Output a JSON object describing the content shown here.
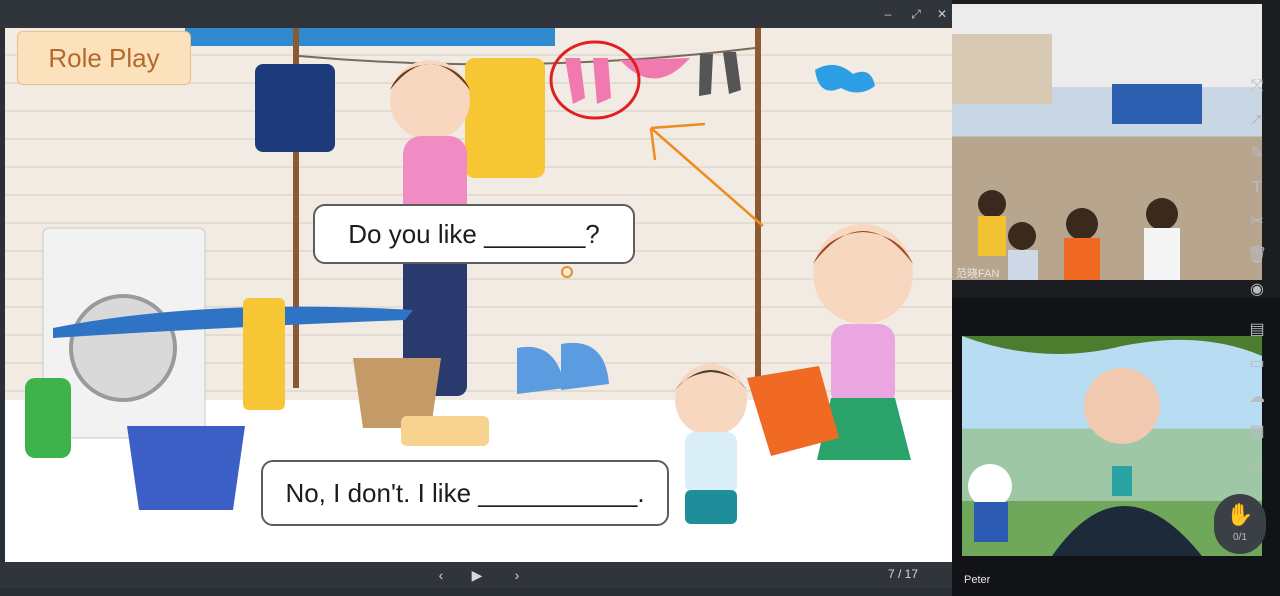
{
  "slide": {
    "title": "Role Play",
    "bubble_question": "Do you like _______?",
    "bubble_answer": "No, I don't. I like ___________.",
    "page_indicator": "7 / 17"
  },
  "navigation": {
    "prev_icon": "‹",
    "play_icon": "▶",
    "next_icon": "›"
  },
  "window": {
    "minimize_icon": "–",
    "restore_icon": "⤢",
    "close_icon": "✕"
  },
  "cameras": {
    "classroom_label": "范晓FAN",
    "teacher_label": "Peter"
  },
  "toolbar": {
    "icons": [
      "cursor-icon",
      "select-icon",
      "pen-icon",
      "text-icon",
      "scissors-icon",
      "trash-icon",
      "eye-icon",
      "edit-icon",
      "chat-icon",
      "cloud-icon",
      "toolbox-icon",
      "users-icon"
    ]
  },
  "hand_raise": {
    "count": "0/1"
  },
  "colors": {
    "accent_orange": "#f08c1e",
    "circle_red": "#e02020",
    "title_badge": "#fbe2bd"
  }
}
